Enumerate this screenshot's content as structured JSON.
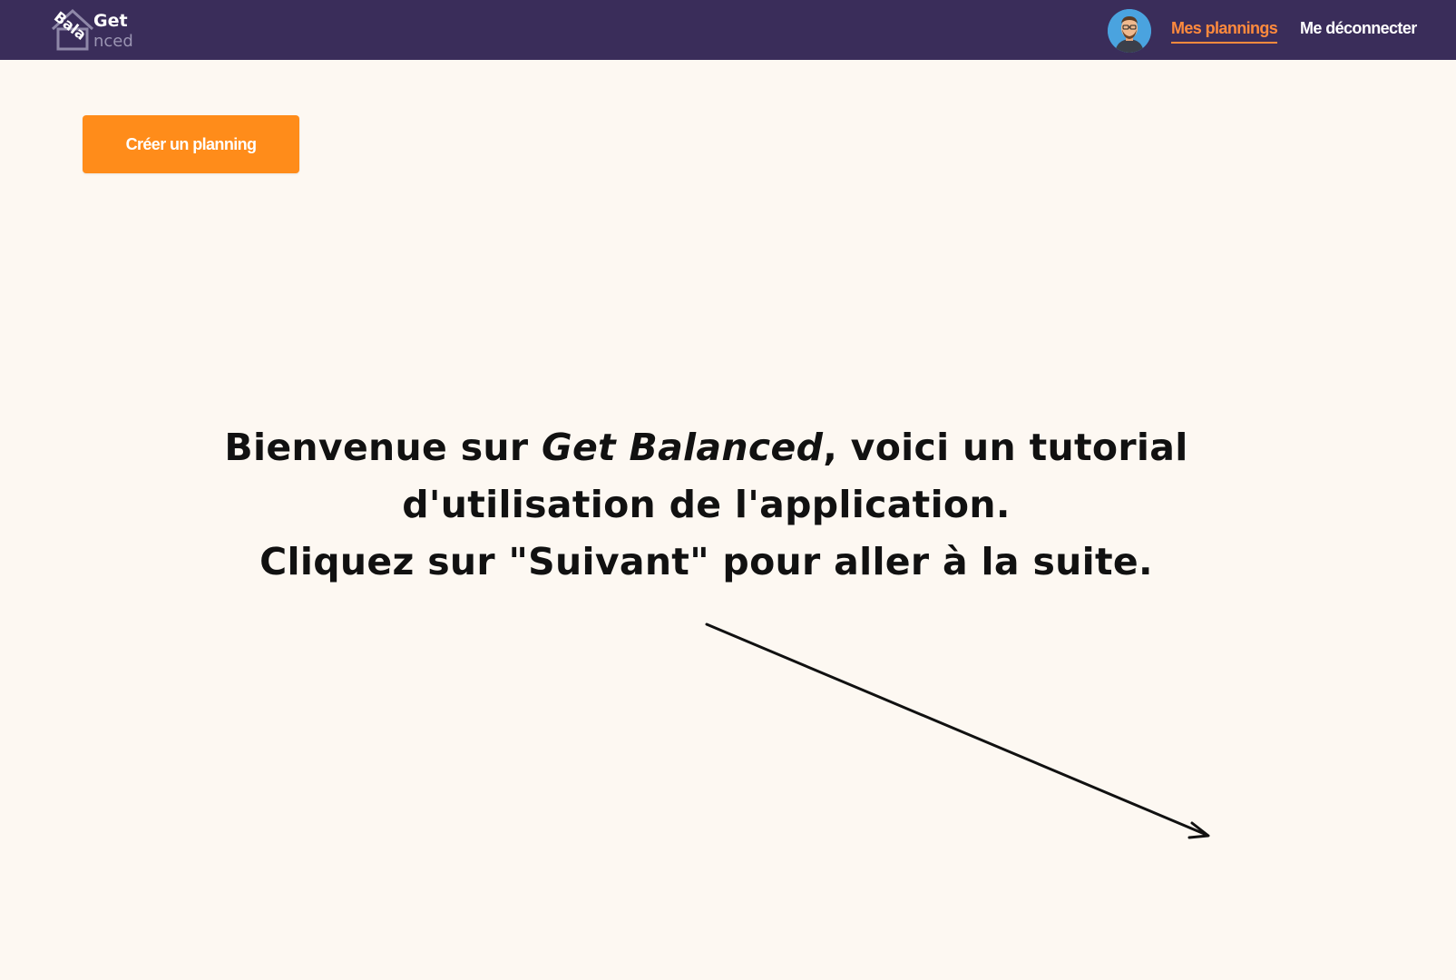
{
  "header": {
    "logo": {
      "line1": "Get",
      "line2_a": "Bala",
      "line2_b": "nced"
    },
    "nav": {
      "plannings_label": "Mes plannings",
      "logout_label": "Me déconnecter"
    },
    "colors": {
      "background": "#3a2d5a",
      "active_link": "#ff8a3d"
    }
  },
  "main": {
    "create_button_label": "Créer un planning",
    "tutorial": {
      "line1_prefix": "Bienvenue sur ",
      "line1_app": "Get Balanced",
      "line1_suffix": ", voici un tutorial",
      "line2": "d'utilisation de l'application.",
      "line3": "Cliquez sur \"Suivant\" pour aller à la suite."
    }
  },
  "colors": {
    "page_background": "#fdf8f2",
    "primary_button": "#ff8c1a"
  }
}
